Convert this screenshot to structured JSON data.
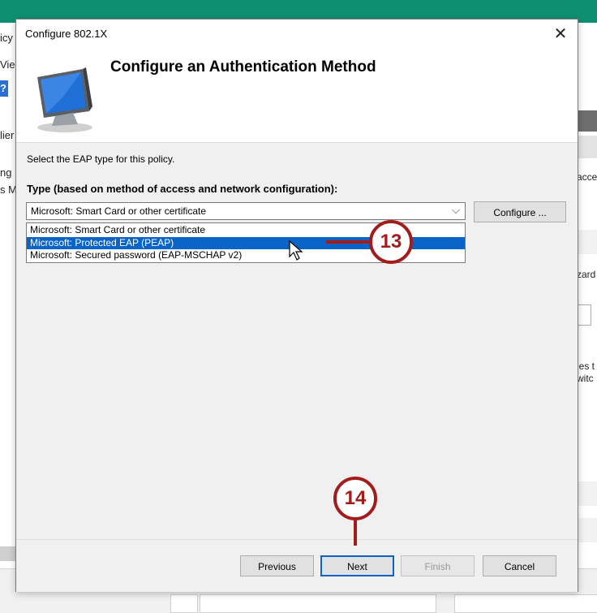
{
  "background": {
    "left_fragments": [
      "icy",
      "Vie",
      "?",
      "lier",
      "ng",
      "s M"
    ],
    "right_fragments": [
      "acce",
      "zard",
      "ies t",
      "witc"
    ]
  },
  "dialog": {
    "title": "Configure 802.1X",
    "close_glyph": "✕",
    "heading": "Configure an Authentication Method",
    "eap_prompt": "Select the EAP type for this policy.",
    "type_label": "Type (based on method of access and network configuration):",
    "combo": {
      "selected_value": "Microsoft: Smart Card or other certificate",
      "chevron": "⌵"
    },
    "options": [
      {
        "label": "Microsoft: Smart Card or other certificate"
      },
      {
        "label": "Microsoft: Protected EAP (PEAP)"
      },
      {
        "label": "Microsoft: Secured password (EAP-MSCHAP v2)"
      }
    ],
    "highlighted_option_index": 1,
    "configure_button": "Configure ...",
    "buttons": {
      "previous": "Previous",
      "next": "Next",
      "finish": "Finish",
      "cancel": "Cancel"
    }
  },
  "annotations": {
    "step_select": "13",
    "step_next": "14",
    "color": "#a31c1c"
  },
  "icons": {
    "dialog_icon": "monitor-icon",
    "pointer": "mouse-cursor-icon"
  }
}
